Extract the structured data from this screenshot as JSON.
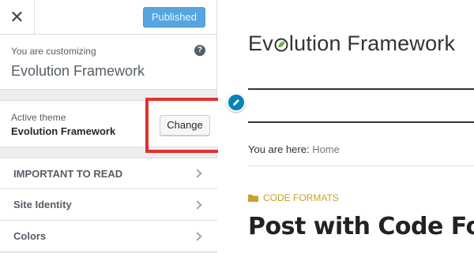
{
  "header": {
    "close_symbol": "✕",
    "publish_label": "Published"
  },
  "customizing": {
    "label": "You are customizing",
    "site_name": "Evolution Framework",
    "help_symbol": "?"
  },
  "theme": {
    "label": "Active theme",
    "name": "Evolution Framework",
    "change_label": "Change",
    "highlight_color": "#e4302b"
  },
  "sections": [
    {
      "label": "IMPORTANT TO READ"
    },
    {
      "label": "Site Identity"
    },
    {
      "label": "Colors"
    }
  ],
  "preview": {
    "site_title_prefix": "E",
    "site_title_rest": "lution Framework",
    "site_title_logo": "v o",
    "breadcrumb_prefix": "You are here: ",
    "breadcrumb_link": "Home",
    "category": "CODE FORMATS",
    "post_title": "Post with Code Form",
    "accent_color": "#c9a227",
    "logo_leaf_color": "#6ab04c"
  },
  "colors": {
    "publish_button": "#55a6e0",
    "edit_shortcut": "#0085ba"
  }
}
